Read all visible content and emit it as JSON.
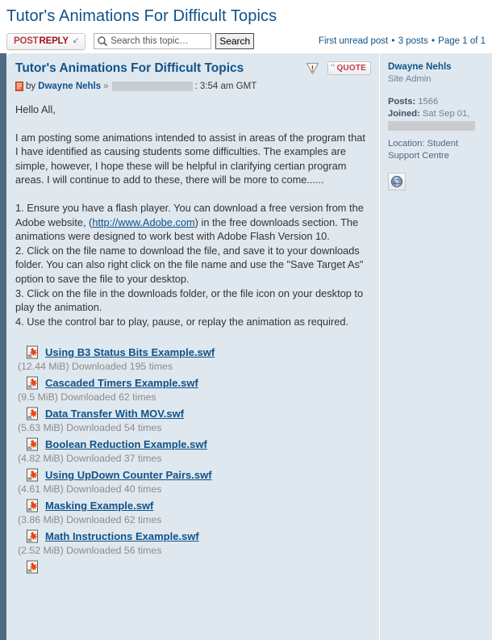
{
  "header": {
    "topic_title": "Tutor's Animations For Difficult Topics",
    "post_reply": {
      "label_part1": "POST",
      "label_part2": "REPLY",
      "arrow": "↙"
    },
    "search": {
      "placeholder": "Search this topic…",
      "value": "",
      "submit_label": "Search",
      "icon": "search-icon"
    },
    "pagination": {
      "first_unread": "First unread post",
      "posts_count": "3 posts",
      "page_info": "Page 1 of 1",
      "separator": "•"
    }
  },
  "post": {
    "subject": "Tutor's Animations For Difficult Topics",
    "report_icon": "warning-triangle-icon",
    "quote_button": {
      "label": "QUOTE",
      "quote_mark": "“"
    },
    "byline": {
      "post_icon": "post-icon",
      "by_label": "by",
      "author": "Dwayne Nehls",
      "separator": "»",
      "date_redacted": true,
      "time": ": 3:54 am GMT"
    },
    "greeting": "Hello All,",
    "intro": "I am posting some animations intended to assist in areas of the program that I have identified as causing students some difficulties. The examples are simple, however, I hope these will be helpful in clarifying certian program areas. I will continue to add to these, there will be more to come......",
    "steps": {
      "step1_before_link": "1. Ensure you have a flash player. You can download a free version from the Adobe website, (",
      "step1_link": "http://www.Adobe.com",
      "step1_after_link": ") in the free downloads section. The animations were designed to work best with Adobe Flash Version 10.",
      "step2": "2. Click on the file name to download the file, and save it to your downloads folder. You can also right click on the file name and use the \"Save Target As\" option to save the file to your desktop.",
      "step3": "3. Click on the file in the downloads folder, or the file icon on your desktop to play the animation.",
      "step4": "4. Use the control bar to play, pause, or replay the animation as required."
    },
    "attachments": [
      {
        "name": "Using B3 Status Bits Example.swf",
        "meta": "(12.44 MiB) Downloaded 195 times"
      },
      {
        "name": "Cascaded Timers Example.swf",
        "meta": "(9.5 MiB) Downloaded 62 times"
      },
      {
        "name": "Data Transfer With MOV.swf",
        "meta": "(5.63 MiB) Downloaded 54 times"
      },
      {
        "name": "Boolean Reduction Example.swf",
        "meta": "(4.82 MiB) Downloaded 37 times"
      },
      {
        "name": "Using UpDown Counter Pairs.swf",
        "meta": "(4.61 MiB) Downloaded 40 times"
      },
      {
        "name": "Masking Example.swf",
        "meta": "(3.86 MiB) Downloaded 62 times"
      },
      {
        "name": "Math Instructions Example.swf",
        "meta": "(2.52 MiB) Downloaded 56 times"
      }
    ],
    "author_panel": {
      "name": "Dwayne Nehls",
      "rank": "Site Admin",
      "posts_label": "Posts:",
      "posts_value": "1566",
      "joined_label": "Joined:",
      "joined_value": "Sat Sep 01,",
      "joined_redacted": true,
      "location_label": "Location:",
      "location_value": "Student Support Centre",
      "website_icon": "globe-icon"
    }
  },
  "colors": {
    "link_blue": "#105289",
    "accent_bar": "#4f6b84",
    "post_bg": "#dfe8ef",
    "muted_gray": "#8b8b8b",
    "reply_red": "#bd3a46"
  }
}
